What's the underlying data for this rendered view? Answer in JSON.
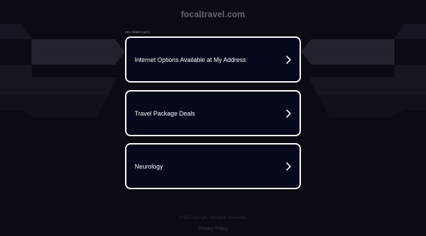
{
  "header": {
    "site_title": "focaltravel.com"
  },
  "related": {
    "label": "See related topics"
  },
  "links": [
    {
      "label": "Internet Options Available at My Address"
    },
    {
      "label": "Travel Package Deals"
    },
    {
      "label": "Neurology"
    }
  ],
  "footer": {
    "copyright": "2025 Copyright. All Rights Reserved.",
    "policy_link": "Privacy Policy"
  },
  "icons": {
    "link_arrow": "chevron-right-icon"
  },
  "colors": {
    "background": "#0b0c13",
    "card_background": "#05091b",
    "card_border": "#ffffff",
    "title_text": "#62646c"
  }
}
